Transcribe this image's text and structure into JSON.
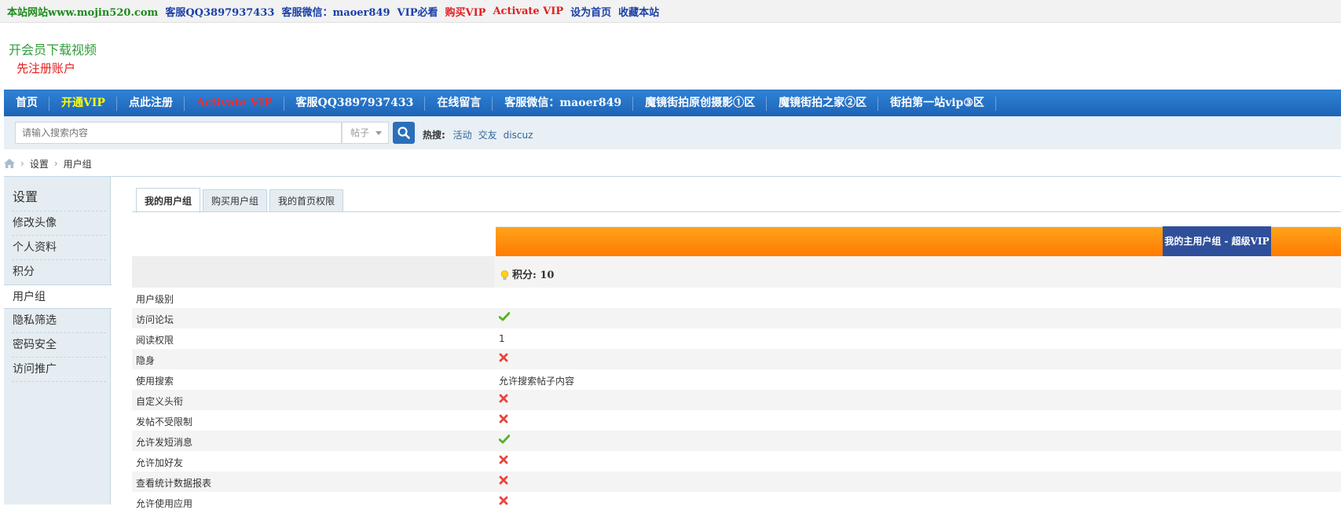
{
  "topbar": {
    "links": [
      {
        "text": "本站网站www.mojin520.com",
        "color": "#1f8a1f"
      },
      {
        "text": "客服QQ3897937433",
        "color": "#1a3fa8"
      },
      {
        "text": "客服微信：maoer849",
        "color": "#1a3fa8"
      },
      {
        "text": "VIP必看",
        "color": "#1a3fa8"
      },
      {
        "text": "购买VIP",
        "color": "#e41e1e"
      },
      {
        "text": "Activate VIP",
        "color": "#e41e1e"
      },
      {
        "text": "设为首页",
        "color": "#1a3fa8"
      },
      {
        "text": "收藏本站",
        "color": "#1a3fa8"
      }
    ]
  },
  "logo": {
    "line1": "开会员下载视频",
    "line2": "先注册账户"
  },
  "nav": {
    "items": [
      {
        "label": "首页",
        "color": "#ffffff"
      },
      {
        "label": "开通VIP",
        "color": "#ffff00"
      },
      {
        "label": "点此注册",
        "color": "#ffffff"
      },
      {
        "label": "Activate VIP",
        "color": "#ff2a2a"
      },
      {
        "label": "客服QQ3897937433",
        "color": "#ffffff"
      },
      {
        "label": "在线留言",
        "color": "#ffffff"
      },
      {
        "label": "客服微信：maoer849",
        "color": "#ffffff"
      },
      {
        "label": "魔镜街拍原创摄影①区",
        "color": "#ffffff"
      },
      {
        "label": "魔镜街拍之家②区",
        "color": "#ffffff"
      },
      {
        "label": "街拍第一站vip③区",
        "color": "#ffffff"
      }
    ]
  },
  "search": {
    "placeholder": "请输入搜索内容",
    "type": "帖子",
    "hot_label": "热搜:",
    "hot_terms": [
      "活动",
      "交友",
      "discuz"
    ]
  },
  "breadcrumb": {
    "items": [
      "设置",
      "用户组"
    ]
  },
  "sidebar": {
    "title": "设置",
    "items": [
      "修改头像",
      "个人资料",
      "积分",
      "用户组",
      "隐私筛选",
      "密码安全",
      "访问推广"
    ],
    "active_index": 3
  },
  "tabs": [
    "我的用户组",
    "购买用户组",
    "我的首页权限"
  ],
  "group": {
    "name": "我的主用户组 - 超级VIP",
    "points_text": "积分: 10"
  },
  "permissions": [
    {
      "label": "用户级别",
      "type": "text",
      "value": ""
    },
    {
      "label": "访问论坛",
      "type": "yes"
    },
    {
      "label": "阅读权限",
      "type": "text",
      "value": "1"
    },
    {
      "label": "隐身",
      "type": "no"
    },
    {
      "label": "使用搜索",
      "type": "text",
      "value": "允许搜索帖子内容"
    },
    {
      "label": "自定义头衔",
      "type": "no"
    },
    {
      "label": "发帖不受限制",
      "type": "no"
    },
    {
      "label": "允许发短消息",
      "type": "yes"
    },
    {
      "label": "允许加好友",
      "type": "no"
    },
    {
      "label": "查看统计数据报表",
      "type": "no"
    },
    {
      "label": "允许使用应用",
      "type": "no"
    }
  ]
}
